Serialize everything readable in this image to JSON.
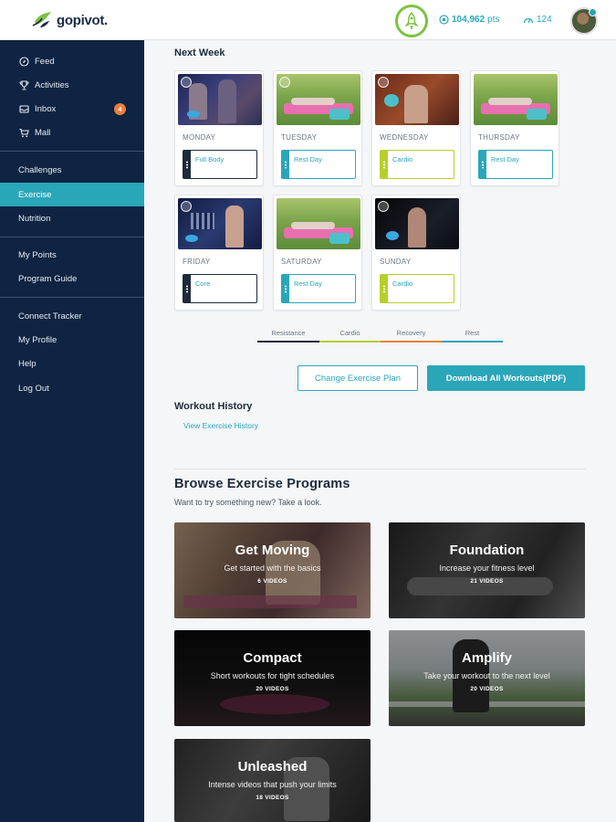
{
  "header": {
    "brand": "gopivot.",
    "points_value": "104,962",
    "points_unit": "pts",
    "steps_value": "124"
  },
  "sidebar": {
    "group1": [
      {
        "label": "Feed",
        "icon": "compass-icon"
      },
      {
        "label": "Activities",
        "icon": "trophy-icon"
      },
      {
        "label": "Inbox",
        "icon": "inbox-icon",
        "badge": "4"
      },
      {
        "label": "Mall",
        "icon": "cart-icon"
      }
    ],
    "group2": [
      "Challenges",
      "Exercise",
      "Nutrition"
    ],
    "group3": [
      "My Points",
      "Program Guide"
    ],
    "group4": [
      "Connect Tracker",
      "My Profile",
      "Help",
      "Log Out"
    ]
  },
  "next_week": {
    "title": "Next Week",
    "days": [
      {
        "day": "MONDAY",
        "workout": "Full Body",
        "color": "#1d2b3a"
      },
      {
        "day": "TUESDAY",
        "workout": "Rest Day",
        "color": "#2aa6b9"
      },
      {
        "day": "WEDNESDAY",
        "workout": "Cardio",
        "color": "#b6cf2a"
      },
      {
        "day": "THURSDAY",
        "workout": "Rest Day",
        "color": "#2aa6b9"
      },
      {
        "day": "FRIDAY",
        "workout": "Core",
        "color": "#1d2b3a"
      },
      {
        "day": "SATURDAY",
        "workout": "Rest Day",
        "color": "#2aa6b9"
      },
      {
        "day": "SUNDAY",
        "workout": "Cardio",
        "color": "#b6cf2a"
      }
    ]
  },
  "legend": [
    {
      "label": "Resistance",
      "color": "#1d2b3a"
    },
    {
      "label": "Cardio",
      "color": "#b6cf2a"
    },
    {
      "label": "Recovery",
      "color": "#ef7d3b"
    },
    {
      "label": "Rest",
      "color": "#2aa6b9"
    }
  ],
  "actions": {
    "change_plan": "Change Exercise Plan",
    "download_all": "Download All Workouts(PDF)"
  },
  "history": {
    "title": "Workout History",
    "link": "View Exercise History"
  },
  "browse": {
    "title": "Browse Exercise Programs",
    "subtitle": "Want to try something new? Take a look.",
    "programs": [
      {
        "title": "Get Moving",
        "desc": "Get started with the basics",
        "count": "6 VIDEOS"
      },
      {
        "title": "Foundation",
        "desc": "Increase your fitness level",
        "count": "21 VIDEOS"
      },
      {
        "title": "Compact",
        "desc": "Short workouts for tight schedules",
        "count": "20 VIDEOS"
      },
      {
        "title": "Amplify",
        "desc": "Take your workout to the next level",
        "count": "20 VIDEOS"
      },
      {
        "title": "Unleashed",
        "desc": "Intense videos that push your limits",
        "count": "18 VIDEOS"
      }
    ]
  },
  "colors": {
    "accent": "#2aa6b9",
    "sidebar": "#0e2442",
    "badge": "#ef7d3b",
    "rocket_ring": "#7cc242"
  }
}
